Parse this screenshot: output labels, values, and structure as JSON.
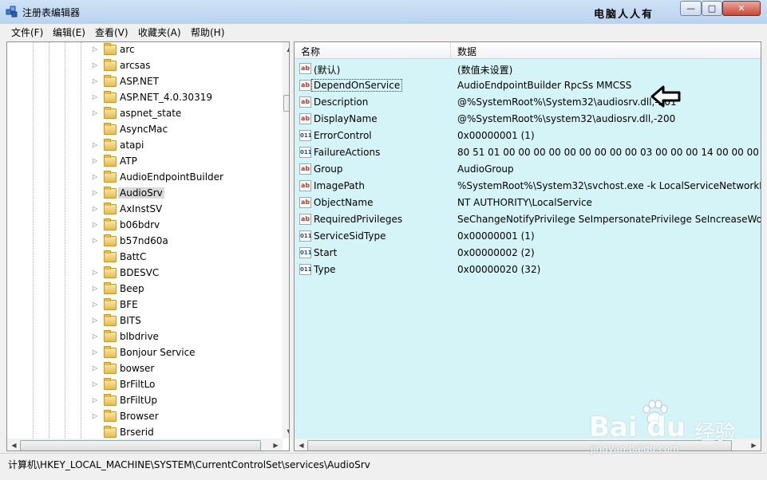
{
  "window": {
    "title": "注册表编辑器",
    "watermark_top": "电脑人人有",
    "controls": {
      "minimize": "—",
      "maximize": "□",
      "close": "✕"
    }
  },
  "menu": {
    "items": [
      "文件(F)",
      "编辑(E)",
      "查看(V)",
      "收藏夹(A)",
      "帮助(H)"
    ]
  },
  "tree": {
    "selected": "AudioSrv",
    "items": [
      {
        "label": "arc",
        "expandable": true
      },
      {
        "label": "arcsas",
        "expandable": true
      },
      {
        "label": "ASP.NET",
        "expandable": true
      },
      {
        "label": "ASP.NET_4.0.30319",
        "expandable": true
      },
      {
        "label": "aspnet_state",
        "expandable": true
      },
      {
        "label": "AsyncMac",
        "expandable": false
      },
      {
        "label": "atapi",
        "expandable": true
      },
      {
        "label": "ATP",
        "expandable": true
      },
      {
        "label": "AudioEndpointBuilder",
        "expandable": true
      },
      {
        "label": "AudioSrv",
        "expandable": true
      },
      {
        "label": "AxInstSV",
        "expandable": true
      },
      {
        "label": "b06bdrv",
        "expandable": true
      },
      {
        "label": "b57nd60a",
        "expandable": true
      },
      {
        "label": "BattC",
        "expandable": false
      },
      {
        "label": "BDESVC",
        "expandable": true
      },
      {
        "label": "Beep",
        "expandable": true
      },
      {
        "label": "BFE",
        "expandable": true
      },
      {
        "label": "BITS",
        "expandable": true
      },
      {
        "label": "blbdrive",
        "expandable": true
      },
      {
        "label": "Bonjour Service",
        "expandable": true
      },
      {
        "label": "bowser",
        "expandable": true
      },
      {
        "label": "BrFiltLo",
        "expandable": true
      },
      {
        "label": "BrFiltUp",
        "expandable": true
      },
      {
        "label": "Browser",
        "expandable": true
      },
      {
        "label": "Brserid",
        "expandable": false
      }
    ]
  },
  "list": {
    "columns": {
      "name": "名称",
      "data": "数据"
    },
    "rows": [
      {
        "icon": "string-value-icon",
        "name": "(默认)",
        "data": "(数值未设置)"
      },
      {
        "icon": "string-value-icon",
        "name": "DependOnService",
        "data": "AudioEndpointBuilder RpcSs MMCSS",
        "focused": true
      },
      {
        "icon": "string-value-icon",
        "name": "Description",
        "data": "@%SystemRoot%\\System32\\audiosrv.dll,-201"
      },
      {
        "icon": "string-value-icon",
        "name": "DisplayName",
        "data": "@%SystemRoot%\\system32\\audiosrv.dll,-200"
      },
      {
        "icon": "binary-value-icon",
        "name": "ErrorControl",
        "data": "0x00000001 (1)"
      },
      {
        "icon": "binary-value-icon",
        "name": "FailureActions",
        "data": "80 51 01 00 00 00 00 00 00 00 00 00 03 00 00 00 14 00 00 00 01"
      },
      {
        "icon": "string-value-icon",
        "name": "Group",
        "data": "AudioGroup"
      },
      {
        "icon": "string-value-icon",
        "name": "ImagePath",
        "data": "%SystemRoot%\\System32\\svchost.exe -k LocalServiceNetworkRe"
      },
      {
        "icon": "string-value-icon",
        "name": "ObjectName",
        "data": "NT AUTHORITY\\LocalService"
      },
      {
        "icon": "string-value-icon",
        "name": "RequiredPrivileges",
        "data": "SeChangeNotifyPrivilege SeImpersonatePrivilege SeIncreaseWorl"
      },
      {
        "icon": "binary-value-icon",
        "name": "ServiceSidType",
        "data": "0x00000001 (1)"
      },
      {
        "icon": "binary-value-icon",
        "name": "Start",
        "data": "0x00000002 (2)"
      },
      {
        "icon": "binary-value-icon",
        "name": "Type",
        "data": "0x00000020 (32)"
      }
    ]
  },
  "icon_text": {
    "string": "ab",
    "binary": "011"
  },
  "status": {
    "path": "计算机\\HKEY_LOCAL_MACHINE\\SYSTEM\\CurrentControlSet\\services\\AudioSrv"
  },
  "watermark": {
    "logo": "Bai du",
    "tag": "经验",
    "url": "jingyan.baidu.com"
  },
  "colors": {
    "list_background": "#d4f4f8",
    "titlebar": "#c4daf3"
  }
}
